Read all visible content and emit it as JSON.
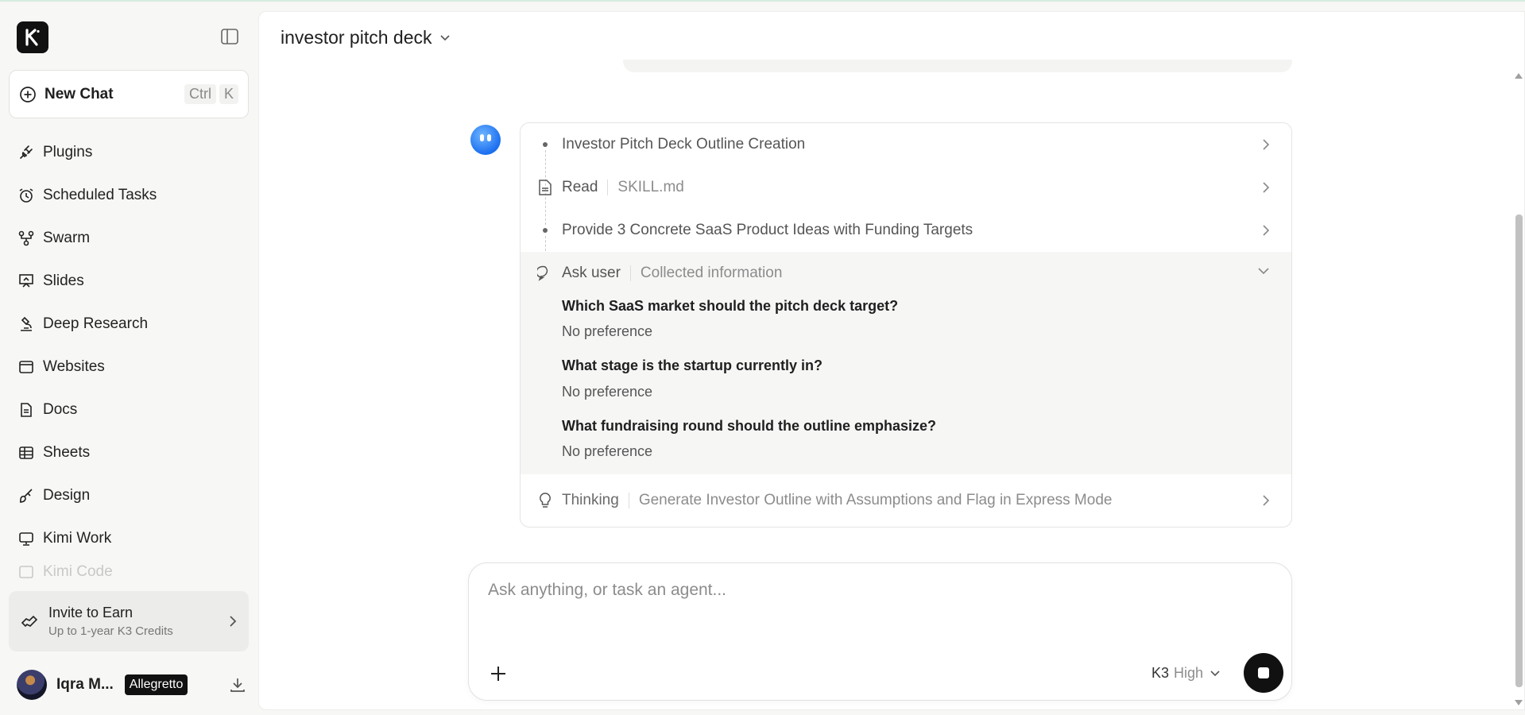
{
  "sidebar": {
    "logo_letter": "K",
    "new_chat": {
      "label": "New Chat",
      "shortcut_1": "Ctrl",
      "shortcut_2": "K"
    },
    "items": [
      {
        "label": "Plugins",
        "icon": "plug-icon"
      },
      {
        "label": "Scheduled Tasks",
        "icon": "alarm-clock-icon"
      },
      {
        "label": "Swarm",
        "icon": "swarm-icon"
      },
      {
        "label": "Slides",
        "icon": "presentation-icon"
      },
      {
        "label": "Deep Research",
        "icon": "microscope-icon"
      },
      {
        "label": "Websites",
        "icon": "browser-window-icon"
      },
      {
        "label": "Docs",
        "icon": "document-icon"
      },
      {
        "label": "Sheets",
        "icon": "table-icon"
      },
      {
        "label": "Design",
        "icon": "brush-icon"
      },
      {
        "label": "Kimi Work",
        "icon": "monitor-icon"
      },
      {
        "label": "Kimi Code",
        "icon": "code-icon"
      }
    ],
    "invite": {
      "title": "Invite to Earn",
      "subtitle": "Up to 1-year K3 Credits"
    },
    "user": {
      "name": "Iqra M...",
      "plan": "Allegretto"
    }
  },
  "main": {
    "title": "investor pitch deck",
    "steps": [
      {
        "label": "Investor Pitch Deck Outline Creation"
      },
      {
        "label": "Read",
        "detail": "SKILL.md"
      },
      {
        "label": "Provide 3 Concrete SaaS Product Ideas with Funding Targets"
      },
      {
        "label": "Ask user",
        "detail": "Collected information"
      },
      {
        "label": "Thinking",
        "detail": "Generate Investor Outline with Assumptions and Flag in Express Mode"
      }
    ],
    "questions": [
      {
        "q": "Which SaaS market should the pitch deck target?",
        "a": "No preference"
      },
      {
        "q": "What stage is the startup currently in?",
        "a": "No preference"
      },
      {
        "q": "What fundraising round should the outline emphasize?",
        "a": "No preference"
      }
    ],
    "composer": {
      "placeholder": "Ask anything, or task an agent...",
      "model": "K3",
      "level": "High"
    }
  },
  "colors": {
    "accent": "#111111",
    "bot": "#1c6ff0",
    "panel": "#f6f6f5"
  }
}
